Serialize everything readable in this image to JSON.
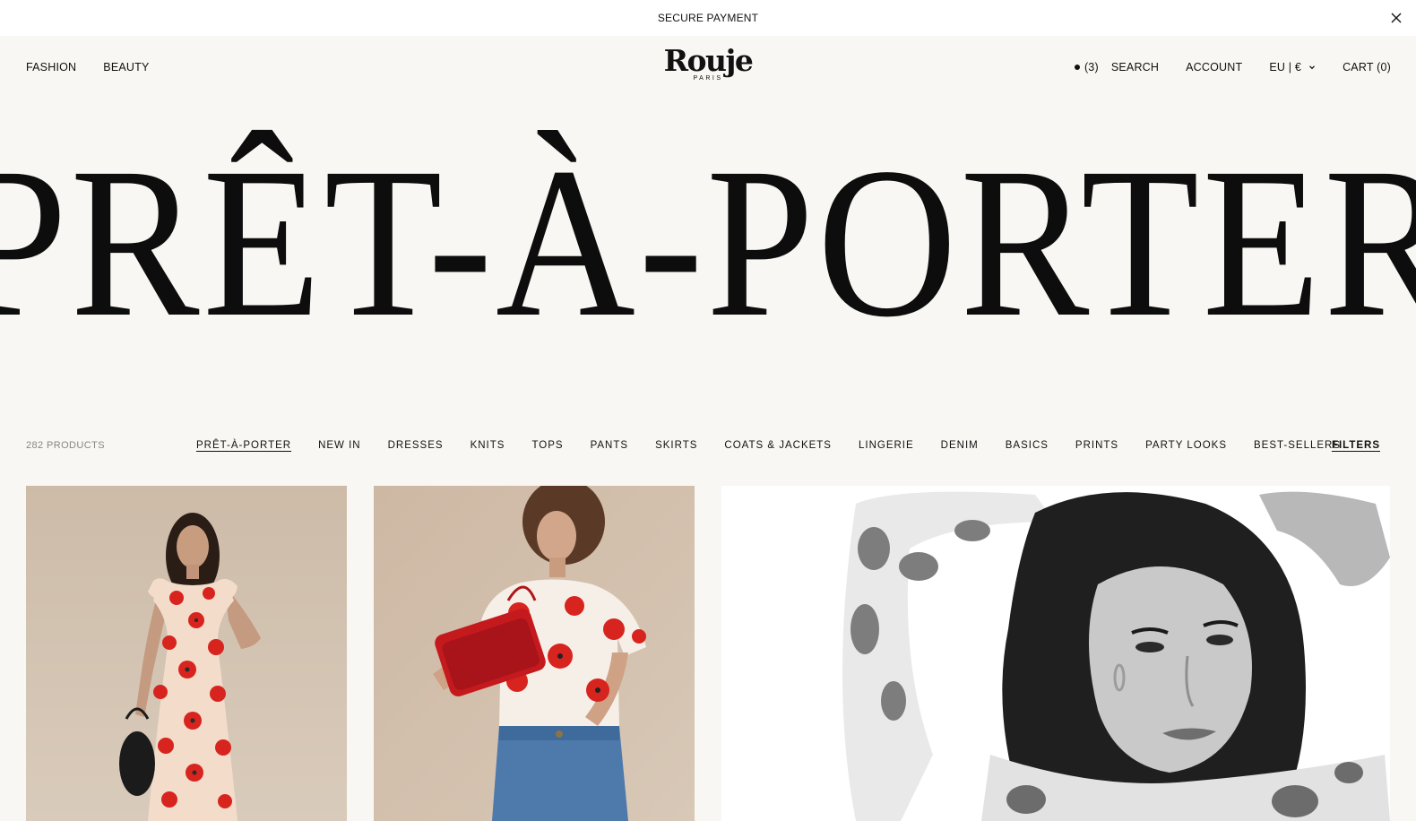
{
  "announcement": {
    "text": "SECURE PAYMENT"
  },
  "header": {
    "nav_left": [
      "FASHION",
      "BEAUTY"
    ],
    "logo": {
      "brand": "Rouje",
      "sub": "PARIS"
    },
    "wishlist_count": "(3)",
    "search": "SEARCH",
    "account": "ACCOUNT",
    "region": "EU | €",
    "cart": "CART (0)"
  },
  "hero": {
    "title": "PRÊT-À-PORTER"
  },
  "category_bar": {
    "product_count": "282 PRODUCTS",
    "categories": [
      "PRÊT-À-PORTER",
      "NEW IN",
      "DRESSES",
      "KNITS",
      "TOPS",
      "PANTS",
      "SKIRTS",
      "COATS & JACKETS",
      "LINGERIE",
      "DENIM",
      "BASICS",
      "PRINTS",
      "PARTY LOOKS",
      "BEST-SELLERS"
    ],
    "active_category": "PRÊT-À-PORTER",
    "filters": "FILTERS"
  },
  "products": [
    {
      "image": "model in red poppy print maxi dress with black basket bag"
    },
    {
      "image": "model in poppy print t-shirt and denim skirt holding red croc bag"
    },
    {
      "image": "black and white portrait of model in floral print blouse"
    }
  ],
  "colors": {
    "page_bg": "#f9f7f3",
    "announce_bg": "#ffffff",
    "text": "#111111",
    "muted": "#8a8680",
    "poppy_red": "#d8241f",
    "photo_beige": "#d3c3b2"
  }
}
